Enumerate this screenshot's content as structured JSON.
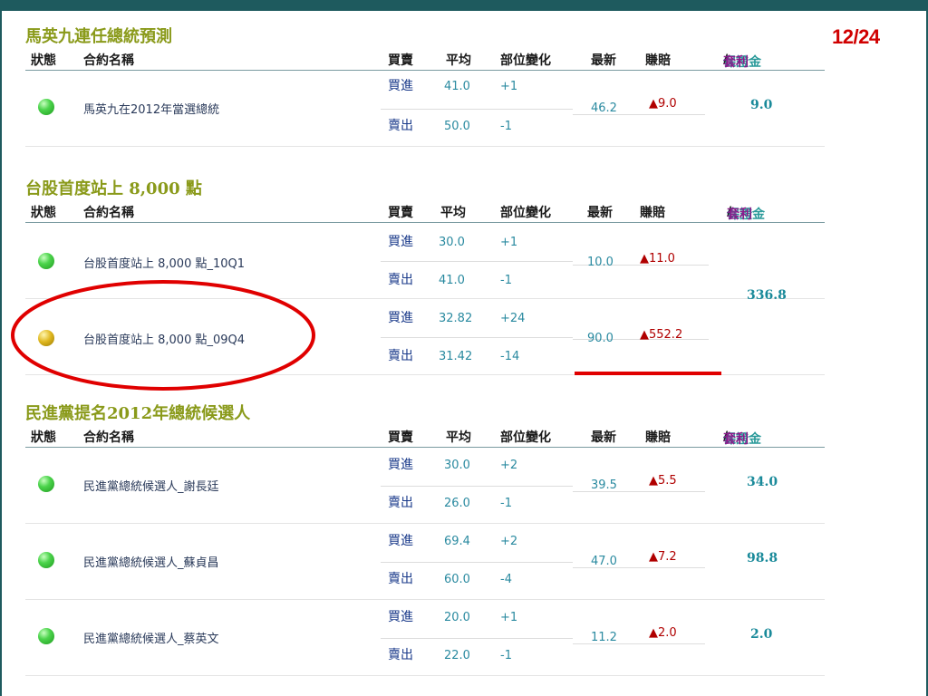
{
  "page": {
    "number": "12/24"
  },
  "headers": {
    "status": "狀態",
    "name": "合約名稱",
    "side": "買賣",
    "avg": "平均",
    "change": "部位變化",
    "latest": "最新",
    "pnl": "賺賠",
    "margin_a": "保證金",
    "slash": "/",
    "margin_b": "套利"
  },
  "sections": [
    {
      "title": "馬英九連任總統預測",
      "contracts": [
        {
          "name": "馬英九在2012年當選總統",
          "status": "green",
          "buy": {
            "side": "買進",
            "avg": "41.0",
            "change": "+1"
          },
          "sell": {
            "side": "賣出",
            "avg": "50.0",
            "change": "-1"
          },
          "latest": "46.2",
          "pnl": "▲9.0",
          "margin": "9.0"
        }
      ]
    },
    {
      "title": "台股首度站上 8,000 點",
      "contracts": [
        {
          "name": "台股首度站上 8,000 點_10Q1",
          "status": "green",
          "buy": {
            "side": "買進",
            "avg": "30.0",
            "change": "+1"
          },
          "sell": {
            "side": "賣出",
            "avg": "41.0",
            "change": "-1"
          },
          "latest": "10.0",
          "pnl": "▲11.0"
        },
        {
          "name": "台股首度站上 8,000 點_09Q4",
          "status": "yellow",
          "buy": {
            "side": "買進",
            "avg": "32.82",
            "change": "+24"
          },
          "sell": {
            "side": "賣出",
            "avg": "31.42",
            "change": "-14"
          },
          "latest": "90.0",
          "pnl": "▲552.2"
        }
      ],
      "margin": "336.8"
    },
    {
      "title": "民進黨提名2012年總統候選人",
      "contracts": [
        {
          "name": "民進黨總統候選人_謝長廷",
          "status": "green",
          "buy": {
            "side": "買進",
            "avg": "30.0",
            "change": "+2"
          },
          "sell": {
            "side": "賣出",
            "avg": "26.0",
            "change": "-1"
          },
          "latest": "39.5",
          "pnl": "▲5.5",
          "margin": "34.0"
        },
        {
          "name": "民進黨總統候選人_蘇貞昌",
          "status": "green",
          "buy": {
            "side": "買進",
            "avg": "69.4",
            "change": "+2"
          },
          "sell": {
            "side": "賣出",
            "avg": "60.0",
            "change": "-4"
          },
          "latest": "47.0",
          "pnl": "▲7.2",
          "margin": "98.8"
        },
        {
          "name": "民進黨總統候選人_蔡英文",
          "status": "green",
          "buy": {
            "side": "買進",
            "avg": "20.0",
            "change": "+1"
          },
          "sell": {
            "side": "賣出",
            "avg": "22.0",
            "change": "-1"
          },
          "latest": "11.2",
          "pnl": "▲2.0",
          "margin": "2.0"
        }
      ]
    }
  ],
  "annotation_color": "#e00000"
}
